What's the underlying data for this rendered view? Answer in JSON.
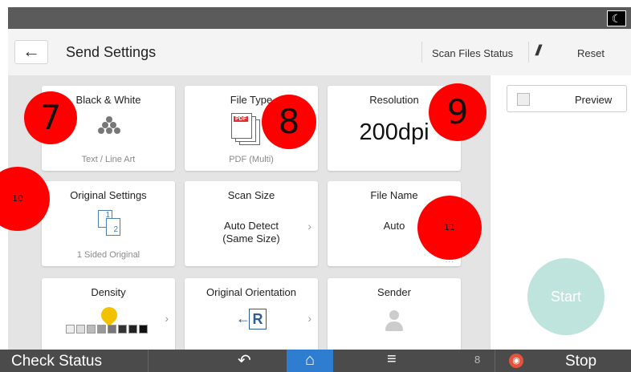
{
  "header": {
    "title": "Send Settings",
    "back_icon": "←",
    "scan_status": "Scan Files Status",
    "reset_icon": "//",
    "reset": "Reset"
  },
  "tiles": {
    "black_white": {
      "title": "Black & White",
      "sub": "Text / Line Art"
    },
    "file_type": {
      "title": "File Type",
      "sub": "PDF (Multi)",
      "icon_text": "PDF"
    },
    "resolution": {
      "title": "Resolution",
      "value": "200dpi"
    },
    "original_settings": {
      "title": "Original Settings",
      "sub": "1 Sided Original",
      "icon_p1": "1",
      "icon_p2": "2"
    },
    "scan_size": {
      "title": "Scan Size",
      "value_line1": "Auto Detect",
      "value_line2": "(Same Size)"
    },
    "file_name": {
      "title": "File Name",
      "value": "Auto",
      "more": "..."
    },
    "density": {
      "title": "Density"
    },
    "orientation": {
      "title": "Original Orientation",
      "icon_letter": "R",
      "icon_arrow": "←"
    },
    "sender": {
      "title": "Sender"
    }
  },
  "right_panel": {
    "preview": "Preview",
    "start": "Start"
  },
  "bottom_bar": {
    "check_status": "Check Status",
    "back_icon": "↶",
    "home_icon": "⌂",
    "menu_icon": "≡",
    "data_icon": "8",
    "stop_icon": "◉",
    "stop": "Stop",
    "moon_icon": "☾"
  },
  "badges": [
    "7",
    "8",
    "9",
    "10",
    "11"
  ],
  "colors": {
    "accent_blue": "#2f7dd1",
    "start_button": "#bfe4dd",
    "badge_red": "#ff0000",
    "stop_red": "#e5533c",
    "density_pin": "#f2c200"
  }
}
